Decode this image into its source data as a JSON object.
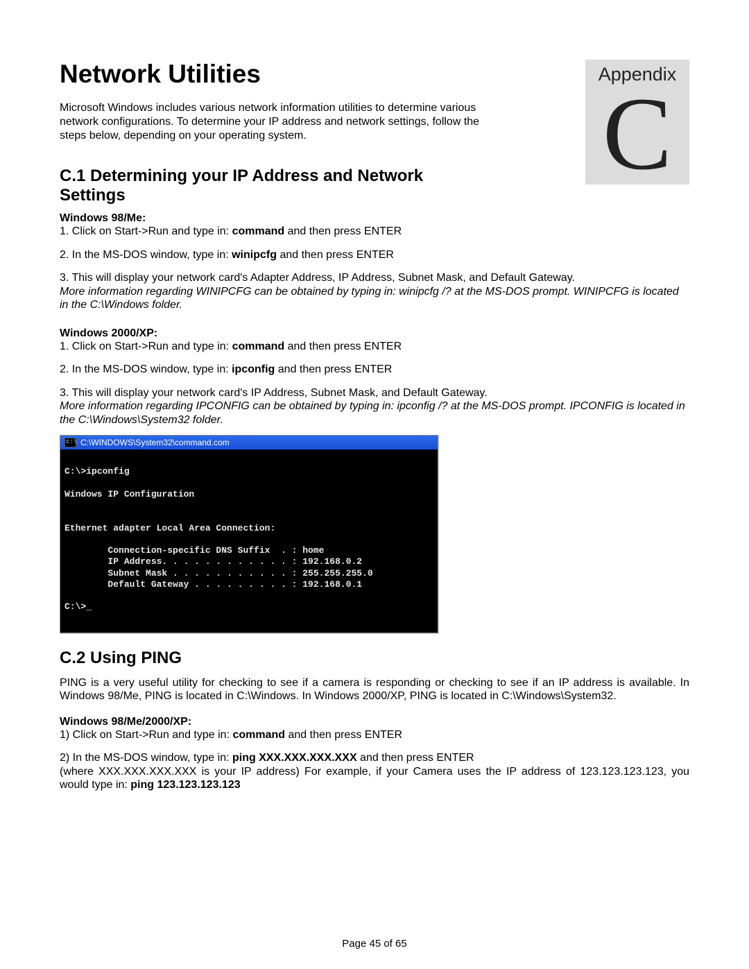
{
  "appendix": {
    "label": "Appendix",
    "letter": "C"
  },
  "title": "Network Utilities",
  "intro": "Microsoft Windows includes various network information utilities to determine various network configurations. To determine your IP address and network settings, follow the steps below, depending on your operating system.",
  "c1": {
    "heading": "C.1 Determining your IP Address and Network Settings",
    "win98": {
      "label": "Windows 98/Me:",
      "s1a": "1. Click on Start->Run and type in: ",
      "s1b": "command",
      "s1c": " and then press ENTER",
      "s2a": "2. In the MS-DOS window, type in: ",
      "s2b": "winipcfg",
      "s2c": " and then press ENTER",
      "s3": "3. This will display your network card's Adapter Address, IP Address, Subnet Mask, and Default Gateway.",
      "more": "More information regarding WINIPCFG can be obtained by typing in: winipcfg /? at the MS-DOS prompt. WINIPCFG is located in the C:\\Windows folder."
    },
    "winxp": {
      "label": "Windows 2000/XP:",
      "s1a": "1. Click on Start->Run and type in: ",
      "s1b": "command",
      "s1c": " and then press ENTER",
      "s2a": "2. In the MS-DOS window, type in: ",
      "s2b": "ipconfig",
      "s2c": " and then press ENTER",
      "s3": "3. This will display your network card's IP Address, Subnet Mask, and Default Gateway.",
      "more": "More information regarding IPCONFIG can be obtained by typing in: ipconfig /? at the MS-DOS prompt. IPCONFIG is located in the C:\\Windows\\System32 folder."
    }
  },
  "terminal": {
    "title": "C:\\WINDOWS\\System32\\command.com",
    "icon_text": "c:\\",
    "body": "\nC:\\>ipconfig\n\nWindows IP Configuration\n\n\nEthernet adapter Local Area Connection:\n\n        Connection-specific DNS Suffix  . : home\n        IP Address. . . . . . . . . . . . : 192.168.0.2\n        Subnet Mask . . . . . . . . . . . : 255.255.255.0\n        Default Gateway . . . . . . . . . : 192.168.0.1\n\nC:\\>_"
  },
  "c2": {
    "heading": "C.2 Using PING",
    "intro": "PING is a very useful utility for checking to see if a camera is responding or checking to see if an IP address is available. In Windows 98/Me, PING is located in C:\\Windows. In Windows 2000/XP, PING is located in C:\\Windows\\System32.",
    "label": "Windows 98/Me/2000/XP:",
    "s1a": "1) Click on Start->Run and type in: ",
    "s1b": "command",
    "s1c": " and then press ENTER",
    "s2a": "2) In the MS-DOS window, type in: ",
    "s2b": "ping XXX.XXX.XXX.XXX",
    "s2c": "  and then press ENTER",
    "s3a": "(where XXX.XXX.XXX.XXX is your IP address) For example, if your Camera uses the IP address of 123.123.123.123, you would type in: ",
    "s3b": "ping 123.123.123.123"
  },
  "footer": "Page 45 of 65"
}
